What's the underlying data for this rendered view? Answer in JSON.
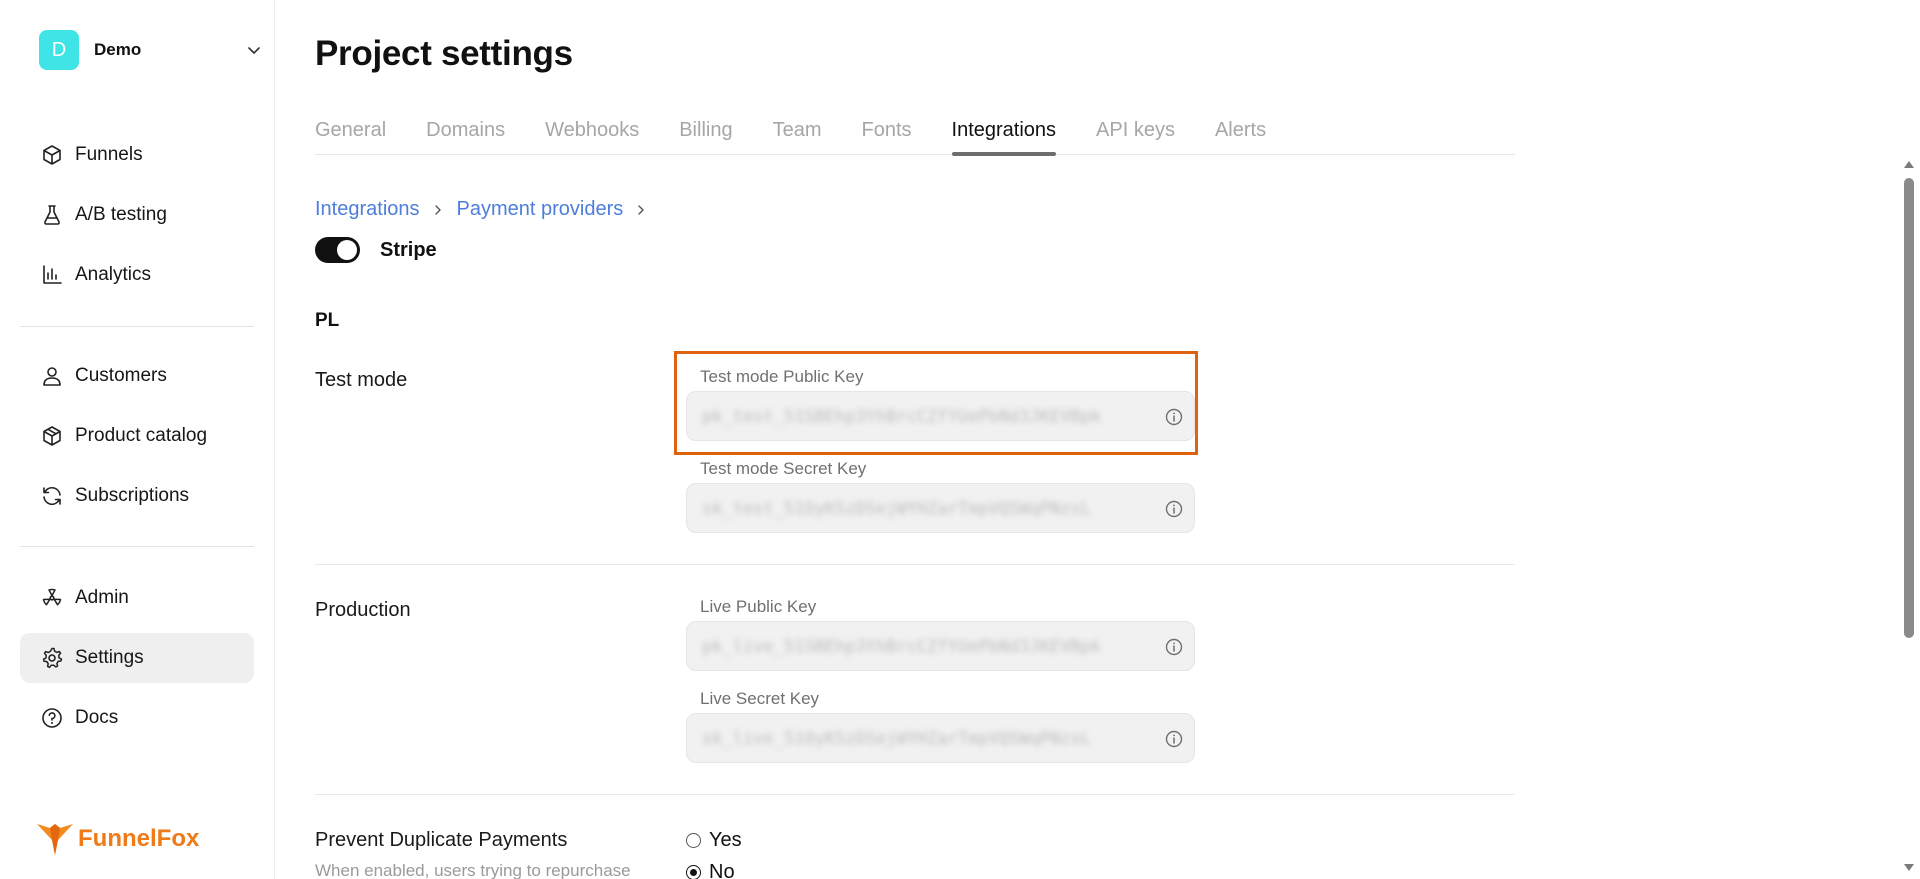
{
  "workspace": {
    "initial": "D",
    "name": "Demo"
  },
  "sidebar": {
    "group1": [
      {
        "label": "Funnels",
        "icon": "box-icon"
      },
      {
        "label": "A/B testing",
        "icon": "flask-icon"
      },
      {
        "label": "Analytics",
        "icon": "bar-chart-icon"
      }
    ],
    "group2": [
      {
        "label": "Customers",
        "icon": "user-icon"
      },
      {
        "label": "Product catalog",
        "icon": "package-icon"
      },
      {
        "label": "Subscriptions",
        "icon": "refresh-icon"
      }
    ],
    "group3": [
      {
        "label": "Admin",
        "icon": "radiation-icon"
      },
      {
        "label": "Settings",
        "icon": "gear-icon",
        "active": true
      },
      {
        "label": "Docs",
        "icon": "help-circle-icon"
      }
    ]
  },
  "brand": {
    "name": "FunnelFox",
    "color": "#f07a18"
  },
  "page": {
    "title": "Project settings",
    "tabs": [
      "General",
      "Domains",
      "Webhooks",
      "Billing",
      "Team",
      "Fonts",
      "Integrations",
      "API keys",
      "Alerts"
    ],
    "active_tab": "Integrations"
  },
  "breadcrumb": [
    "Integrations",
    "Payment providers"
  ],
  "provider": {
    "name": "Stripe",
    "enabled": true
  },
  "section_code": "PL",
  "test_mode": {
    "label": "Test mode",
    "public_key_label": "Test mode Public Key",
    "public_key_value": "pk_test_51SBEhp3YhBrcCZfYUePbNd3JKEVBpk",
    "secret_key_label": "Test mode Secret Key",
    "secret_key_value": "sk_test_51OyKSzDSejWYHZarTmpVQSWqPNzsL"
  },
  "production": {
    "label": "Production",
    "public_key_label": "Live Public Key",
    "public_key_value": "pk_live_51SBEhp3YhBrcCZfYUePbNd3JKEVBpk",
    "secret_key_label": "Live Secret Key",
    "secret_key_value": "sk_live_51OyKSzDSejWYHZarTmpVQSWqPNzsL"
  },
  "duplicate_payments": {
    "label": "Prevent Duplicate Payments",
    "description": "When enabled, users trying to repurchase",
    "options": [
      "Yes",
      "No"
    ],
    "selected": "No"
  },
  "colors": {
    "accent_link": "#4e7ddc",
    "highlight": "#e0620f",
    "avatar": "#3ee4e6"
  }
}
